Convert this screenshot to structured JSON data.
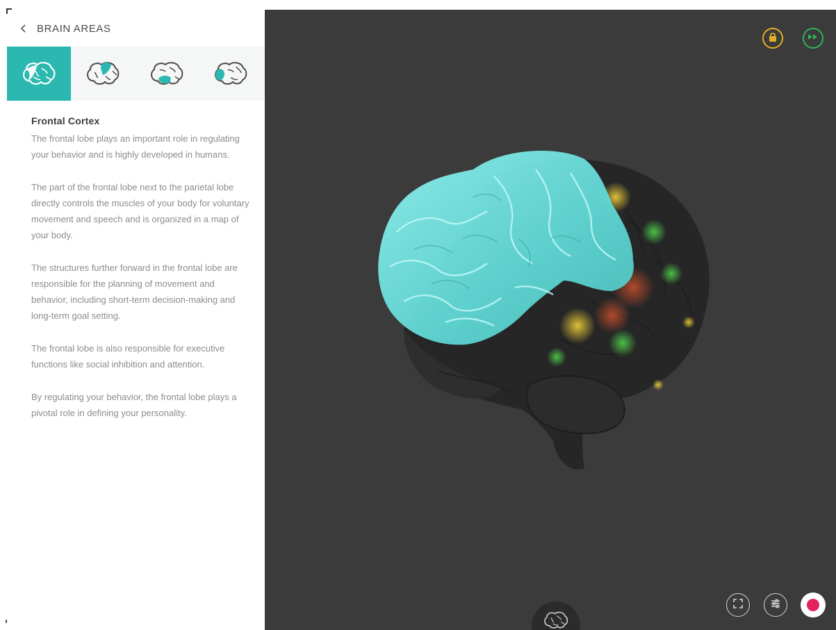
{
  "header": {
    "title": "BRAIN AREAS",
    "back_icon": "chevron-left-icon"
  },
  "area_tabs": [
    {
      "icon": "brain-frontal-icon",
      "selected": true
    },
    {
      "icon": "brain-parietal-icon",
      "selected": false
    },
    {
      "icon": "brain-temporal-icon",
      "selected": false
    },
    {
      "icon": "brain-occipital-icon",
      "selected": false
    }
  ],
  "content": {
    "title": "Frontal Cortex",
    "paragraphs": [
      "The frontal lobe plays an important role in regulating your behavior and is highly developed in humans.",
      "The part of the frontal lobe next to the parietal lobe directly controls the muscles of your body for voluntary movement and speech and is organized in a map of your body.",
      "The structures further forward in the frontal lobe are responsible for the planning of movement and behavior, including short-term decision-making and long-term goal setting.",
      "The frontal lobe is also responsible for executive functions like social inhibition and attention.",
      "By regulating your behavior, the frontal lobe plays a pivotal role in defining your personality."
    ]
  },
  "viewer": {
    "top_controls": [
      {
        "icon": "lock-icon",
        "color": "#e2b01f"
      },
      {
        "icon": "forward-icon",
        "color": "#2fb35b"
      }
    ],
    "bottom_controls": [
      {
        "icon": "expand-icon"
      },
      {
        "icon": "sliders-icon"
      },
      {
        "icon": "record-icon",
        "color": "#e5245e"
      }
    ],
    "brain_toggle_icon": "brain-icon",
    "highlight_color": "#6fe3e0",
    "background_color": "#3b3b3b"
  }
}
